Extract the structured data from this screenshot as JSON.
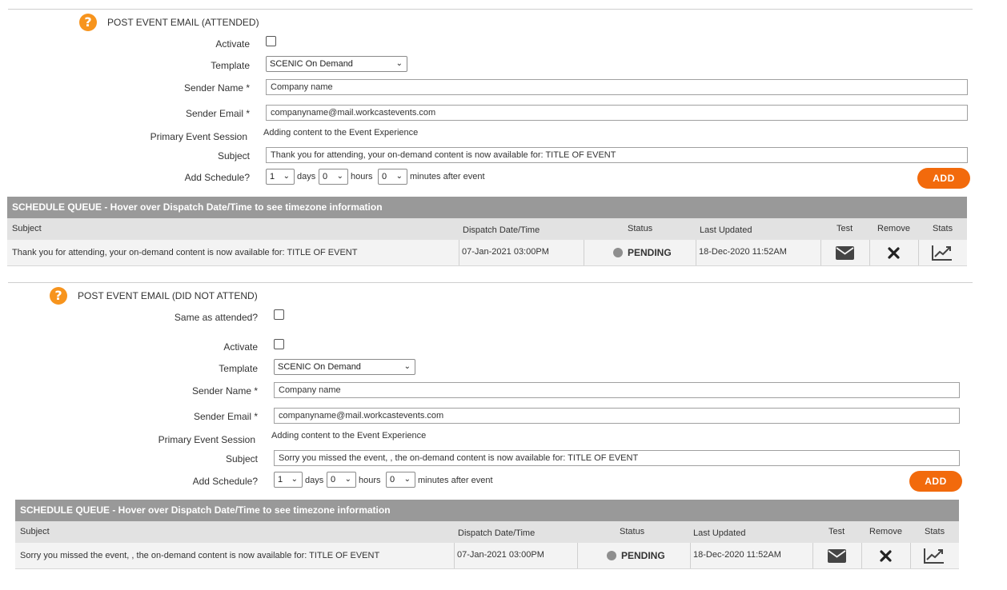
{
  "section1": {
    "title": "POST EVENT EMAIL (ATTENDED)",
    "activate_label": "Activate",
    "template_label": "Template",
    "template_value": "SCENIC On Demand",
    "sender_name_label": "Sender Name *",
    "sender_name_value": "Company name",
    "sender_email_label": "Sender Email *",
    "sender_email_value": "companyname@mail.workcastevents.com",
    "primary_session_label": "Primary Event Session",
    "primary_session_value": "Adding content to the Event Experience",
    "subject_label": "Subject",
    "subject_value": "Thank you for attending, your on-demand content is now available for: TITLE OF EVENT",
    "schedule_label": "Add Schedule?",
    "days_value": "1",
    "days_label": "days",
    "hours_value": "0",
    "hours_label": "hours",
    "minutes_value": "0",
    "minutes_label": "minutes after event",
    "add_button": "ADD",
    "queue": {
      "header": "SCHEDULE QUEUE - Hover over Dispatch Date/Time to see timezone information",
      "columns": {
        "subject": "Subject",
        "dispatch": "Dispatch Date/Time",
        "status": "Status",
        "updated": "Last Updated",
        "test": "Test",
        "remove": "Remove",
        "stats": "Stats"
      },
      "rows": [
        {
          "subject": "Thank you for attending, your on-demand content is now available for: TITLE OF EVENT",
          "dispatch": "07-Jan-2021 03:00PM",
          "status": "PENDING",
          "updated": "18-Dec-2020 11:52AM"
        }
      ]
    }
  },
  "section2": {
    "title": "POST EVENT EMAIL (DID NOT ATTEND)",
    "same_label": "Same as attended?",
    "activate_label": "Activate",
    "template_label": "Template",
    "template_value": "SCENIC On Demand",
    "sender_name_label": "Sender Name *",
    "sender_name_value": "Company name",
    "sender_email_label": "Sender Email *",
    "sender_email_value": "companyname@mail.workcastevents.com",
    "primary_session_label": "Primary Event Session",
    "primary_session_value": "Adding content to the Event Experience",
    "subject_label": "Subject",
    "subject_value": "Sorry you missed the event, , the on-demand content is now available for: TITLE OF EVENT",
    "schedule_label": "Add Schedule?",
    "days_value": "1",
    "days_label": "days",
    "hours_value": "0",
    "hours_label": "hours",
    "minutes_value": "0",
    "minutes_label": "minutes after event",
    "add_button": "ADD",
    "queue": {
      "header": "SCHEDULE QUEUE - Hover over Dispatch Date/Time to see timezone information",
      "columns": {
        "subject": "Subject",
        "dispatch": "Dispatch Date/Time",
        "status": "Status",
        "updated": "Last Updated",
        "test": "Test",
        "remove": "Remove",
        "stats": "Stats"
      },
      "rows": [
        {
          "subject": "Sorry you missed the event, , the on-demand content is now available for: TITLE OF EVENT",
          "dispatch": "07-Jan-2021 03:00PM",
          "status": "PENDING",
          "updated": "18-Dec-2020 11:52AM"
        }
      ]
    }
  },
  "icons": {
    "help": "question-circle-icon",
    "dropdown": "chevron-down-icon",
    "test": "envelope-icon",
    "remove": "close-icon",
    "stats": "line-chart-icon",
    "status": "status-dot-icon"
  },
  "colors": {
    "accent": "#f26a0c",
    "help": "#f7941d",
    "queue_header": "#999999",
    "status_dot": "#8e8e8e"
  }
}
